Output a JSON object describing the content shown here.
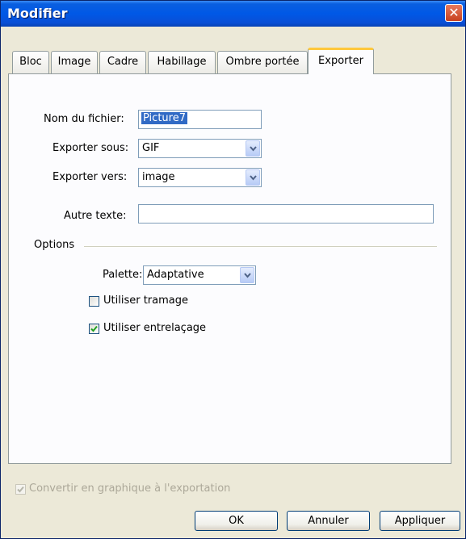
{
  "window": {
    "title": "Modifier",
    "close_glyph": "✕"
  },
  "tabs": [
    {
      "label": "Bloc",
      "active": false
    },
    {
      "label": "Image",
      "active": false
    },
    {
      "label": "Cadre",
      "active": false
    },
    {
      "label": "Habillage",
      "active": false
    },
    {
      "label": "Ombre portée",
      "active": false
    },
    {
      "label": "Exporter",
      "active": true
    }
  ],
  "form": {
    "filename_label": "Nom du fichier:",
    "filename_value": "Picture7",
    "export_as_label": "Exporter sous:",
    "export_as_value": "GIF",
    "export_to_label": "Exporter vers:",
    "export_to_value": "image",
    "alt_text_label": "Autre texte:",
    "alt_text_value": ""
  },
  "options": {
    "heading": "Options",
    "palette_label": "Palette:",
    "palette_value": "Adaptative",
    "dither_label": "Utiliser tramage",
    "dither_checked": false,
    "interlace_label": "Utiliser entrelaçage",
    "interlace_checked": true
  },
  "footer": {
    "convert_label": "Convertir en graphique à l'exportation",
    "convert_checked": true,
    "convert_disabled": true
  },
  "buttons": {
    "ok": "OK",
    "cancel": "Annuler",
    "apply": "Appliquer"
  },
  "colors": {
    "titlebar": "#0058E6",
    "dialog_bg": "#ECE9D8",
    "panel_bg": "#FCFCFE",
    "selection": "#316AC5",
    "check_green": "#21A121",
    "close_red": "#D2502E",
    "active_tab_accent": "#FFC83C"
  }
}
